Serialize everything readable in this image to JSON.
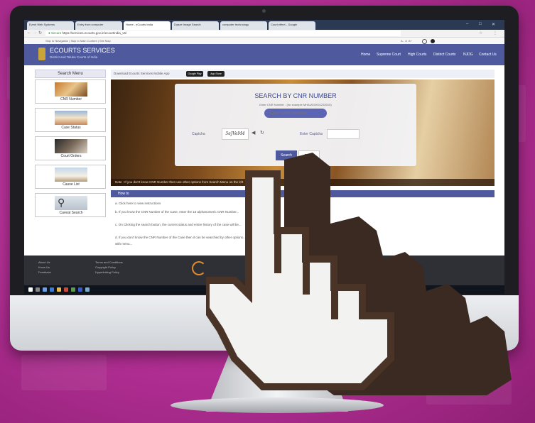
{
  "browser": {
    "tabs": [
      "Event Web Systems",
      "Entry from computer",
      "Home - eCourts India",
      "Daaze Image Search",
      "computer technology",
      "Court effect - Google"
    ],
    "url": "https://services.ecourts.gov.in/ecourtindia_v6/",
    "secure_label": "Secure",
    "bookmarks": "Skip to Navigation  |  Skip to Main Content  |  Site Map"
  },
  "site": {
    "title": "ECOURTS SERVICES",
    "subtitle": "District and Taluka Courts of India",
    "nav": [
      "Home",
      "Supreme Court",
      "High Courts",
      "District Courts",
      "NJDG",
      "Contact Us"
    ]
  },
  "menu": {
    "heading": "Search Menu",
    "items": [
      "CNR Number",
      "Case Status",
      "Court Orders",
      "Cause List",
      "Caveat Search"
    ]
  },
  "banner": {
    "text": "Download Ecourts Services Mobile App",
    "buttons": [
      "Google Play",
      "App Store"
    ]
  },
  "search": {
    "title": "SEARCH BY CNR NUMBER",
    "hint": "Enter CNR Number - (for example MHAU010001232015)",
    "placeholder": "Enter CNR Number",
    "captcha_label": "Captcha",
    "captcha_text": "5eJVeM4",
    "captcha_input_label": "Enter Captcha",
    "search_button": "Search",
    "reset_button": "Reset",
    "hero_note": "Note : If you don't know CNR Number then use other options from Search Menu on the left"
  },
  "howto": {
    "heading": "How to",
    "steps": [
      "a. Click here to view instructions",
      "b. If you know the CNR Number of the Case, enter the 16 alphanumeric CNR Number...",
      "c. On Clicking the search button, the current status and entire history of the case will be...",
      "d. If you don't know the CNR Number of the Case then it can be searched by other options...",
      "with menu..."
    ]
  },
  "footer": {
    "col1": [
      "About Us",
      "Know Us",
      "Feedback"
    ],
    "col2": [
      "Terms and Conditions",
      "Copyright Policy",
      "Hyperlinking Policy"
    ]
  }
}
